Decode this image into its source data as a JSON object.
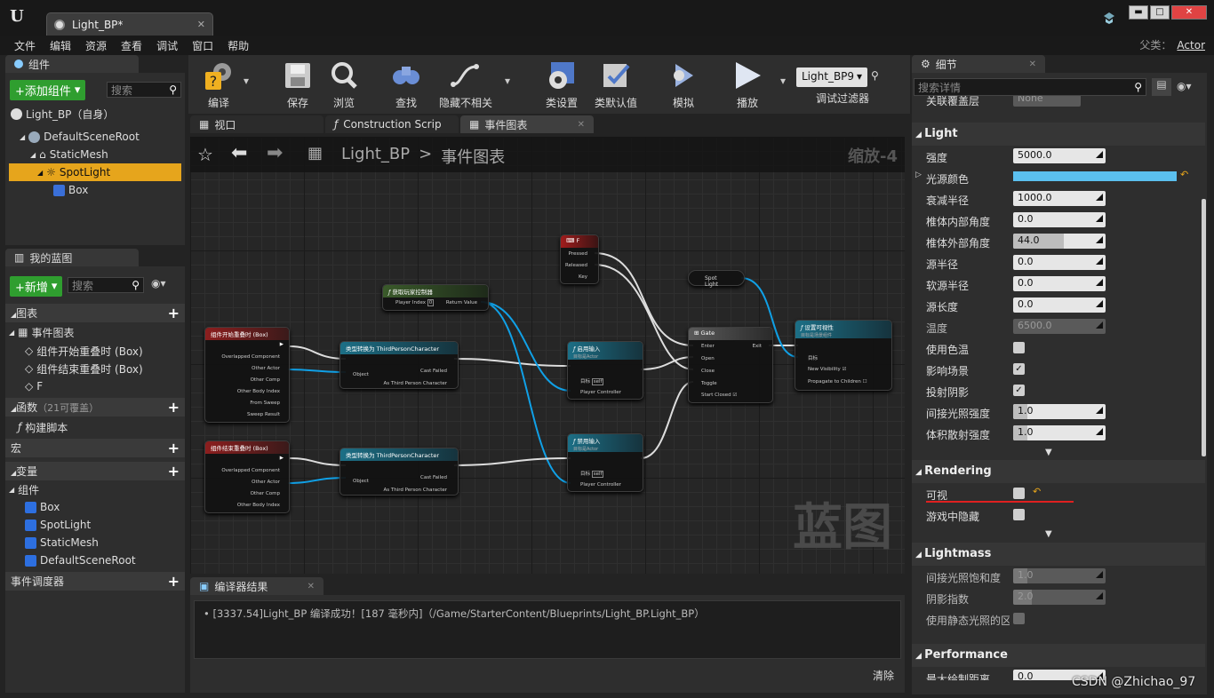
{
  "window": {
    "tab_title": "Light_BP*",
    "tab_close": "✕",
    "min_label": "▬",
    "max_label": "□",
    "close_label": "✕"
  },
  "menu": {
    "items": [
      "文件",
      "编辑",
      "资源",
      "查看",
      "调试",
      "窗口",
      "帮助"
    ],
    "parent_label": "父类：",
    "parent_value": "Actor"
  },
  "components_panel": {
    "tab": "组件",
    "add_button": "+添加组件",
    "search_placeholder": "搜索",
    "self_item": "Light_BP（自身）",
    "tree": [
      "DefaultSceneRoot",
      "StaticMesh",
      "SpotLight",
      "Box"
    ]
  },
  "blueprint_panel": {
    "tab": "我的蓝图",
    "new_button": "+新增",
    "search_placeholder": "搜索",
    "graphs_label": "图表",
    "event_graph": "事件图表",
    "events": [
      "组件开始重叠时 (Box)",
      "组件结束重叠时 (Box)",
      "F"
    ],
    "functions_label": "函数",
    "functions_count": "（21可覆盖）",
    "construction": "构建脚本",
    "macros": "宏",
    "variables": "变量",
    "components_label": "组件",
    "components": [
      "Box",
      "SpotLight",
      "StaticMesh",
      "DefaultSceneRoot"
    ],
    "dispatchers": "事件调度器"
  },
  "toolbar": {
    "compile": "编译",
    "save": "保存",
    "browse": "浏览",
    "find": "查找",
    "hide_unrelated": "隐藏不相关",
    "class_settings": "类设置",
    "class_defaults": "类默认值",
    "simulate": "模拟",
    "play": "播放",
    "debug_object": "Light_BP9",
    "debug_filter": "调试过滤器"
  },
  "editor_tabs": [
    "视口",
    "Construction Scrip",
    "事件图表"
  ],
  "graph": {
    "breadcrumb_root": "Light_BP",
    "breadcrumb_sep": ">",
    "breadcrumb_current": "事件图表",
    "zoom": "缩放-4",
    "watermark": "蓝图",
    "nodes": {
      "begin_overlap": {
        "title": "组件开始重叠时 (Box)",
        "pins": [
          "Overlapped Component",
          "Other Actor",
          "Other Comp",
          "Other Body Index",
          "From Sweep",
          "Sweep Result"
        ]
      },
      "end_overlap": {
        "title": "组件结束重叠时 (Box)",
        "pins": [
          "Overlapped Component",
          "Other Actor",
          "Other Comp",
          "Other Body Index"
        ]
      },
      "cast1": {
        "title": "类型转换为 ThirdPersonCharacter",
        "object": "Object",
        "cast_failed": "Cast Failed",
        "as": "As Third Person Character"
      },
      "cast2": {
        "title": "类型转换为 ThirdPersonCharacter",
        "object": "Object",
        "cast_failed": "Cast Failed",
        "as": "As Third Person Character"
      },
      "get_pc": {
        "title": "获取玩家控制器",
        "player_index": "Player Index",
        "index_value": "0",
        "return": "Return Value"
      },
      "f_key": {
        "title": "F",
        "pressed": "Pressed",
        "released": "Released",
        "key": "Key"
      },
      "enable_input": {
        "title": "启用输入",
        "subtitle": "目标是Actor",
        "target": "目标",
        "self": "self",
        "pc": "Player Controller"
      },
      "disable_input": {
        "title": "禁用输入",
        "subtitle": "目标是Actor",
        "target": "目标",
        "self": "self",
        "pc": "Player Controller"
      },
      "spotlight": {
        "title": "Spot Light"
      },
      "gate": {
        "title": "Gate",
        "enter": "Enter",
        "exit": "Exit",
        "open": "Open",
        "close": "Close",
        "toggle": "Toggle",
        "start_closed": "Start Closed"
      },
      "set_visibility": {
        "title": "设置可视性",
        "subtitle": "目标是场景组件",
        "target": "目标",
        "new_visibility": "New Visibility",
        "propagate": "Propagate to Children"
      }
    }
  },
  "compiler": {
    "tab": "编译器结果",
    "message": "[3337.54]Light_BP 编译成功！[187 毫秒内]（/Game/StarterContent/Blueprints/Light_BP.Light_BP）",
    "clear": "清除"
  },
  "details": {
    "tab": "细节",
    "search_placeholder": "搜索详情",
    "partial_row": "关联覆盖层",
    "partial_value": "None",
    "light_section": "Light",
    "rows": [
      {
        "label": "强度",
        "value": "5000.0",
        "fill": 0
      },
      {
        "label": "光源颜色",
        "color": "#5bc0ef"
      },
      {
        "label": "衰减半径",
        "value": "1000.0",
        "fill": 0
      },
      {
        "label": "椎体内部角度",
        "value": "0.0",
        "fill": 0
      },
      {
        "label": "椎体外部角度",
        "value": "44.0",
        "fill": 0.55
      },
      {
        "label": "源半径",
        "value": "0.0",
        "fill": 0
      },
      {
        "label": "软源半径",
        "value": "0.0",
        "fill": 0
      },
      {
        "label": "源长度",
        "value": "0.0",
        "fill": 0
      },
      {
        "label": "温度",
        "value": "6500.0",
        "fill": 0,
        "disabled": true
      },
      {
        "label": "使用色温",
        "check": false
      },
      {
        "label": "影响场景",
        "check": true
      },
      {
        "label": "投射阴影",
        "check": true
      },
      {
        "label": "间接光照强度",
        "value": "1.0",
        "fill": 0.15
      },
      {
        "label": "体积散射强度",
        "value": "1.0",
        "fill": 0.15
      }
    ],
    "rendering_section": "Rendering",
    "rendering_rows": [
      {
        "label": "可视",
        "check": false,
        "highlight": true
      },
      {
        "label": "游戏中隐藏",
        "check": false
      }
    ],
    "lightmass_section": "Lightmass",
    "lightmass_rows": [
      {
        "label": "间接光照饱和度",
        "value": "1.0",
        "fill": 0.15,
        "disabled": true
      },
      {
        "label": "阴影指数",
        "value": "2.0",
        "fill": 0.2,
        "disabled": true
      },
      {
        "label": "使用静态光照的区域",
        "check": false,
        "disabled": true
      }
    ],
    "performance_section": "Performance",
    "performance_rows": [
      {
        "label": "最大绘制距离",
        "value": "0.0",
        "fill": 0
      }
    ]
  },
  "watermark_text": "CSDN @Zhichao_97",
  "colors": {
    "accent_yellow": "#e6a51c",
    "exec_white": "#ffffff",
    "object_blue": "#10a0e6",
    "green": "#2f9e2f"
  }
}
